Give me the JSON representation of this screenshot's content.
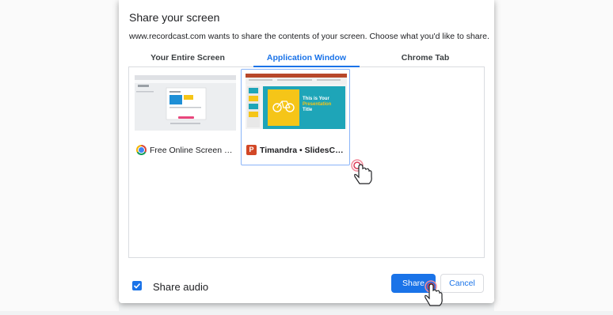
{
  "dialog": {
    "title": "Share your screen",
    "subtitle": "www.recordcast.com wants to share the contents of your screen. Choose what you'd like to share."
  },
  "tabs": [
    {
      "label": "Your Entire Screen",
      "active": false
    },
    {
      "label": "Application Window",
      "active": true
    },
    {
      "label": "Chrome Tab",
      "active": false
    }
  ],
  "sources": [
    {
      "label": "Free Online Screen Re...",
      "icon": "chrome-icon",
      "selected": false
    },
    {
      "label": "Timandra • SlidesCar...",
      "icon": "powerpoint-icon",
      "selected": true
    }
  ],
  "thumbnail_slide": {
    "line1": "This is Your",
    "line2": "Presentation",
    "line3": "Title"
  },
  "footer": {
    "share_audio_label": "Share audio",
    "share_audio_checked": true,
    "share_button": "Share",
    "cancel_button": "Cancel"
  },
  "colors": {
    "accent": "#1a73e8",
    "slide_teal": "#1ea5b8",
    "slide_yellow": "#f5c518",
    "ppt_red": "#d24726"
  }
}
